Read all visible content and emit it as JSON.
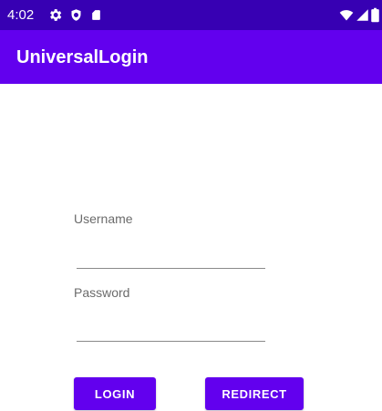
{
  "status_bar": {
    "time": "4:02",
    "left_icons": [
      "settings-icon",
      "shield-icon",
      "sd-card-icon"
    ],
    "right_icons": [
      "wifi-icon",
      "signal-icon",
      "battery-icon"
    ]
  },
  "app_bar": {
    "title": "UniversalLogin"
  },
  "form": {
    "username_label": "Username",
    "username_value": "",
    "password_label": "Password",
    "password_value": ""
  },
  "buttons": {
    "login_label": "LOGIN",
    "redirect_label": "REDIRECT"
  },
  "colors": {
    "status_bar": "#3700B3",
    "app_bar": "#6200EE",
    "button": "#6200EE"
  }
}
